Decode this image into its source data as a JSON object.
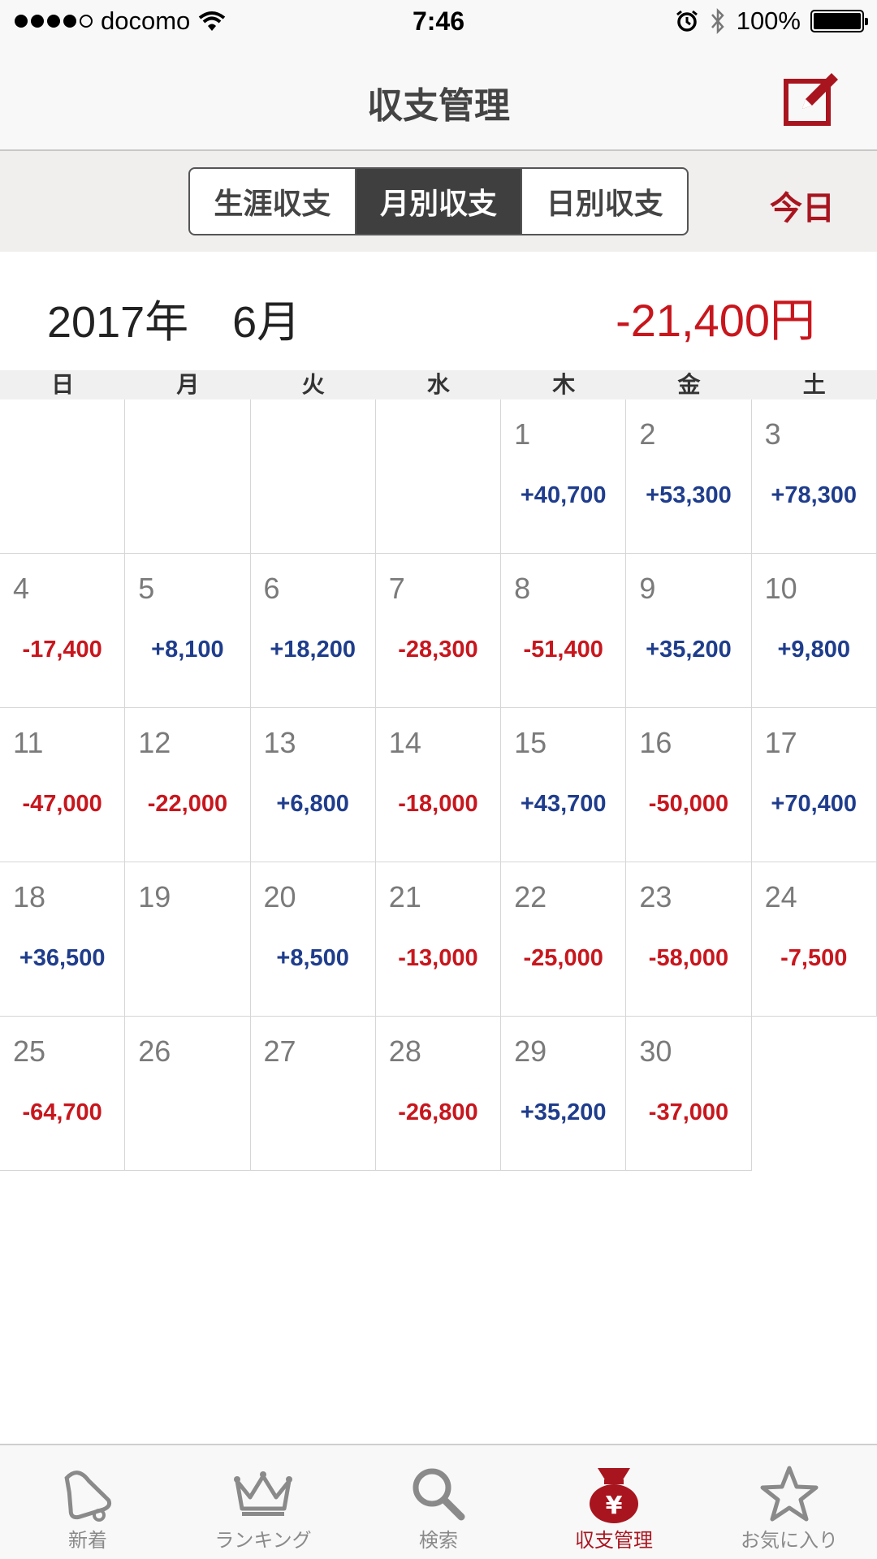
{
  "status_bar": {
    "carrier": "docomo",
    "time": "7:46",
    "battery": "100%"
  },
  "nav": {
    "title": "収支管理",
    "compose_icon": "compose-icon"
  },
  "segments": [
    {
      "label": "生涯収支",
      "active": false
    },
    {
      "label": "月別収支",
      "active": true
    },
    {
      "label": "日別収支",
      "active": false
    }
  ],
  "today_label": "今日",
  "month": {
    "label": "2017年　6月",
    "total": "-21,400円"
  },
  "weekdays": [
    "日",
    "月",
    "火",
    "水",
    "木",
    "金",
    "土"
  ],
  "calendar": {
    "weeks": [
      [
        null,
        null,
        null,
        null,
        {
          "day": "1",
          "amount": "+40,700"
        },
        {
          "day": "2",
          "amount": "+53,300"
        },
        {
          "day": "3",
          "amount": "+78,300"
        }
      ],
      [
        {
          "day": "4",
          "amount": "-17,400"
        },
        {
          "day": "5",
          "amount": "+8,100"
        },
        {
          "day": "6",
          "amount": "+18,200"
        },
        {
          "day": "7",
          "amount": "-28,300"
        },
        {
          "day": "8",
          "amount": "-51,400"
        },
        {
          "day": "9",
          "amount": "+35,200"
        },
        {
          "day": "10",
          "amount": "+9,800"
        }
      ],
      [
        {
          "day": "11",
          "amount": "-47,000"
        },
        {
          "day": "12",
          "amount": "-22,000"
        },
        {
          "day": "13",
          "amount": "+6,800"
        },
        {
          "day": "14",
          "amount": "-18,000"
        },
        {
          "day": "15",
          "amount": "+43,700"
        },
        {
          "day": "16",
          "amount": "-50,000"
        },
        {
          "day": "17",
          "amount": "+70,400"
        }
      ],
      [
        {
          "day": "18",
          "amount": "+36,500"
        },
        {
          "day": "19",
          "amount": ""
        },
        {
          "day": "20",
          "amount": "+8,500"
        },
        {
          "day": "21",
          "amount": "-13,000"
        },
        {
          "day": "22",
          "amount": "-25,000"
        },
        {
          "day": "23",
          "amount": "-58,000"
        },
        {
          "day": "24",
          "amount": "-7,500"
        }
      ],
      [
        {
          "day": "25",
          "amount": "-64,700"
        },
        {
          "day": "26",
          "amount": ""
        },
        {
          "day": "27",
          "amount": ""
        },
        {
          "day": "28",
          "amount": "-26,800"
        },
        {
          "day": "29",
          "amount": "+35,200"
        },
        {
          "day": "30",
          "amount": "-37,000"
        },
        null
      ]
    ]
  },
  "tabs": [
    {
      "label": "新着",
      "icon": "bell-icon",
      "active": false
    },
    {
      "label": "ランキング",
      "icon": "crown-icon",
      "active": false
    },
    {
      "label": "検索",
      "icon": "search-icon",
      "active": false
    },
    {
      "label": "収支管理",
      "icon": "money-bag-icon",
      "active": true
    },
    {
      "label": "お気に入り",
      "icon": "star-icon",
      "active": false
    }
  ],
  "colors": {
    "accent": "#a8151f",
    "positive": "#1f3d8c",
    "negative": "#c8161d"
  }
}
